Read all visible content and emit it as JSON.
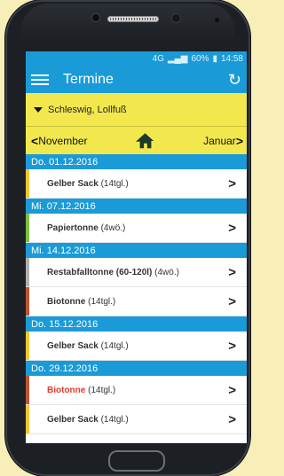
{
  "status": {
    "network": "4G",
    "battery": "60%",
    "time": "14:58"
  },
  "toolbar": {
    "title": "Termine",
    "menu_icon": "menu-icon",
    "refresh_icon": "refresh-icon"
  },
  "location": {
    "label": "Schleswig, Lollfuß"
  },
  "monthbar": {
    "prev": "November",
    "next": "Januar",
    "home_icon": "home-icon"
  },
  "colors": {
    "blue": "#1a9bd7",
    "yellow": "#f2e84e",
    "gelb": "#f4c531",
    "papier": "#7ac142",
    "rest": "#b0b0b0",
    "bio": "#c0532f",
    "alert": "#e53a2b"
  },
  "days": [
    {
      "date": "Do. 01.12.2016",
      "entries": [
        {
          "name": "Gelber Sack",
          "freq": "(14tgl.)"
        }
      ]
    },
    {
      "date": "Mi. 07.12.2016",
      "entries": [
        {
          "name": "Papiertonne",
          "freq": "(4wö.)"
        }
      ]
    },
    {
      "date": "Mi. 14.12.2016",
      "entries": [
        {
          "name": "Restabfalltonne (60-120l)",
          "freq": "(4wö.)"
        },
        {
          "name": "Biotonne",
          "freq": "(14tgl.)"
        }
      ]
    },
    {
      "date": "Do. 15.12.2016",
      "entries": [
        {
          "name": "Gelber Sack",
          "freq": "(14tgl.)"
        }
      ]
    },
    {
      "date": "Do. 29.12.2016",
      "entries": [
        {
          "name": "Biotonne",
          "freq": "(14tgl.)"
        },
        {
          "name": "Gelber Sack",
          "freq": "(14tgl.)"
        }
      ]
    }
  ]
}
